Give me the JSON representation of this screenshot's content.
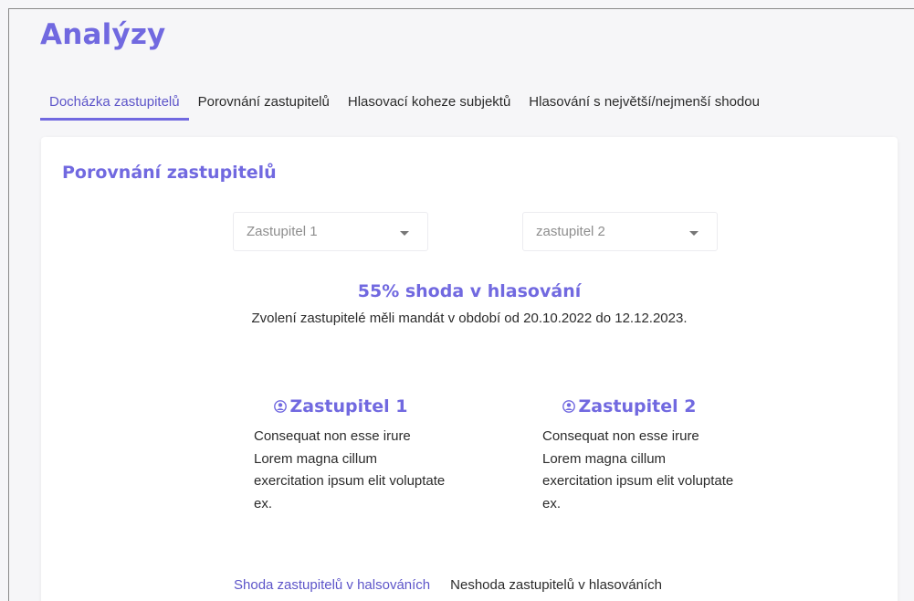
{
  "page": {
    "title": "Analýzy"
  },
  "tabs": [
    {
      "label": "Docházka zastupitelů",
      "active": true
    },
    {
      "label": "Porovnání zastupitelů",
      "active": false
    },
    {
      "label": "Hlasovací koheze subjektů",
      "active": false
    },
    {
      "label": "Hlasování s největší/nejmenší shodou",
      "active": false
    }
  ],
  "card": {
    "title": "Porovnání zastupitelů",
    "select1": {
      "value": "Zastupitel 1"
    },
    "select2": {
      "value": "zastupitel 2"
    },
    "match_text": "55% shoda v hlasování",
    "mandate_text": "Zvolení zastupitelé měli mandát v období od 20.10.2022 do 12.12.2023.",
    "rep1": {
      "name": "Zastupitel 1",
      "icon": "user-icon",
      "description": "Consequat non esse irure Lorem magna cillum exercitation ipsum elit voluptate ex."
    },
    "rep2": {
      "name": "Zastupitel 2",
      "icon": "user-icon",
      "description": "Consequat non esse irure Lorem magna cillum exercitation ipsum elit voluptate ex."
    },
    "subtabs": [
      {
        "label": "Shoda zastupitelů v halsováních",
        "active": true
      },
      {
        "label": "Neshoda zastupitelů v hlasováních",
        "active": false
      }
    ]
  },
  "colors": {
    "accent": "#7169e0",
    "text": "#2b2b2b",
    "background": "#f6f6f8"
  }
}
